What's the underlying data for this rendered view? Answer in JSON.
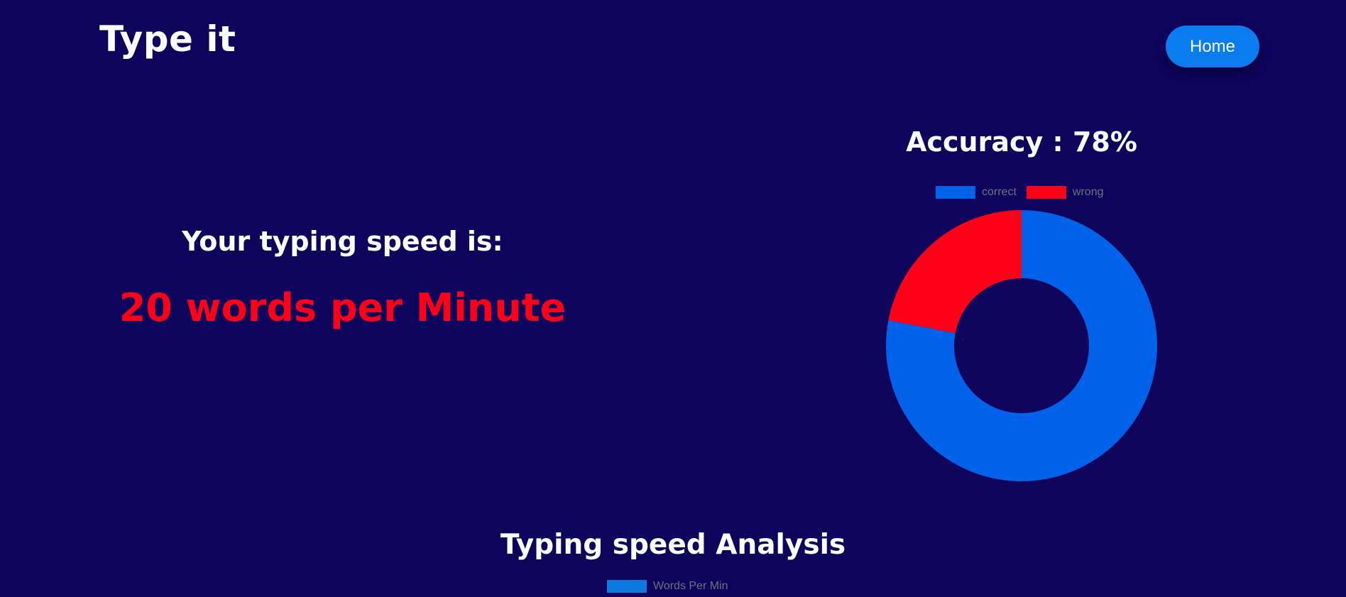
{
  "header": {
    "logo": "Type it",
    "home_label": "Home"
  },
  "result": {
    "label": "Your typing speed is:",
    "value": "20 words per Minute"
  },
  "accuracy": {
    "title": "Accuracy : 78%"
  },
  "analysis": {
    "title": "Typing speed Analysis"
  },
  "colors": {
    "background": "#0e045c",
    "correct": "#0062e8",
    "wrong": "#ff0018",
    "words_per_min": "#0a7ae0",
    "button": "#0a7cf0"
  },
  "chart_data": [
    {
      "type": "pie",
      "variant": "doughnut",
      "labels": [
        "correct",
        "wrong"
      ],
      "values": [
        78,
        22
      ],
      "colors": [
        "#0062e8",
        "#ff0018"
      ],
      "legend": "top"
    },
    {
      "type": "line",
      "series": [
        {
          "name": "Words Per Min",
          "color": "#0a7ae0",
          "values": []
        }
      ],
      "legend": "top"
    }
  ]
}
